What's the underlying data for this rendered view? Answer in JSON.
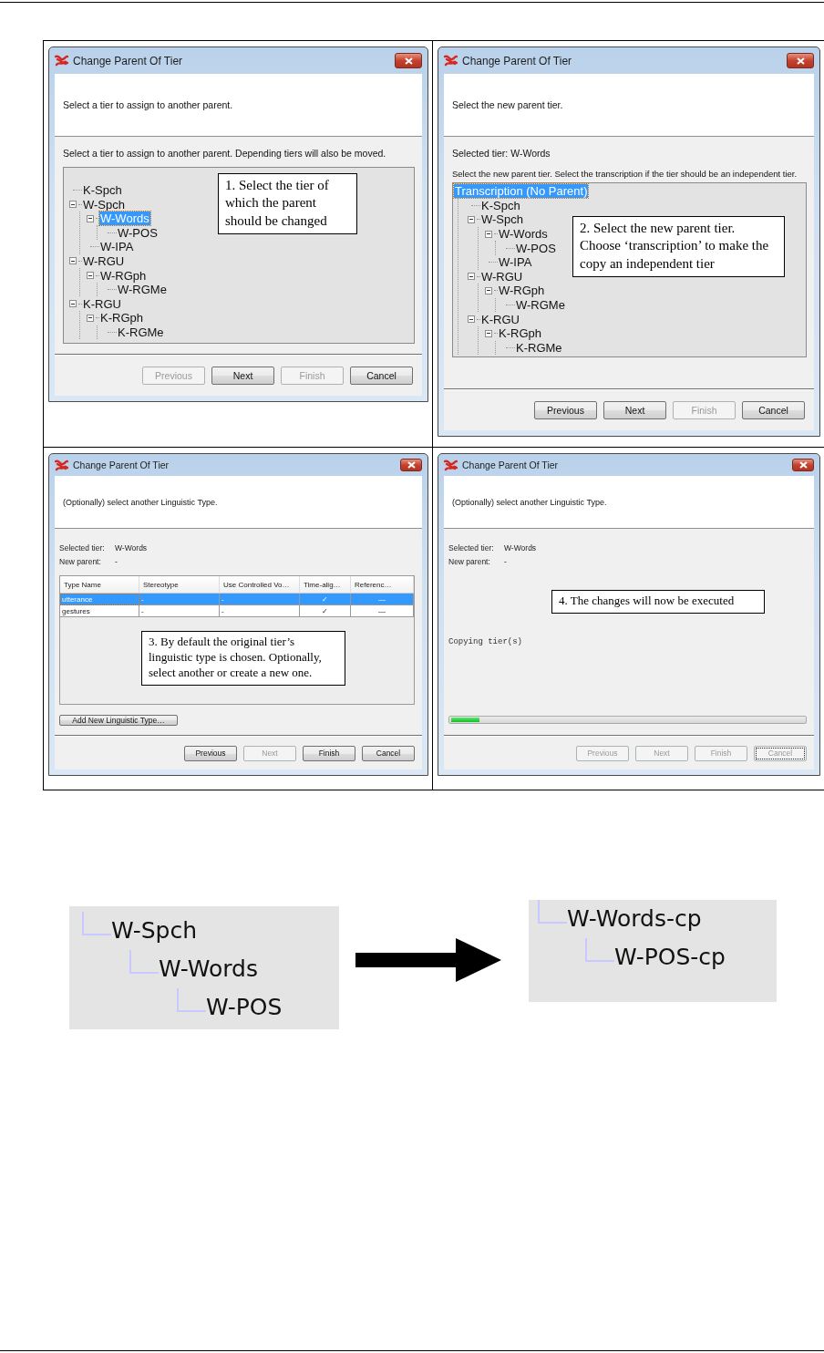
{
  "panels": [
    {
      "kind": "tier_select",
      "title": "Change Parent Of Tier",
      "header": "Select a tier to assign to another parent.",
      "prompt": "Select a tier to assign to another parent. Depending tiers will also be moved.",
      "tree": [
        {
          "label": "K-Spch",
          "selected": false
        },
        {
          "label": "W-Spch",
          "selected": false,
          "expanded": true,
          "children": [
            {
              "label": "W-Words",
              "selected": true,
              "expanded": true,
              "children": [
                {
                  "label": "W-POS",
                  "selected": false
                }
              ]
            },
            {
              "label": "W-IPA",
              "selected": false
            }
          ]
        },
        {
          "label": "W-RGU",
          "selected": false,
          "expanded": true,
          "children": [
            {
              "label": "W-RGph",
              "selected": false,
              "expanded": true,
              "children": [
                {
                  "label": "W-RGMe",
                  "selected": false
                }
              ]
            }
          ]
        },
        {
          "label": "K-RGU",
          "selected": false,
          "expanded": true,
          "children": [
            {
              "label": "K-RGph",
              "selected": false,
              "expanded": true,
              "children": [
                {
                  "label": "K-RGMe",
                  "selected": false
                }
              ]
            }
          ]
        }
      ],
      "callout": "1. Select the tier of which the parent should be changed",
      "buttons": [
        {
          "label": "Previous",
          "disabled": true,
          "focused": false
        },
        {
          "label": "Next",
          "disabled": false,
          "focused": false
        },
        {
          "label": "Finish",
          "disabled": true,
          "focused": false
        },
        {
          "label": "Cancel",
          "disabled": false,
          "focused": false
        }
      ]
    },
    {
      "kind": "parent_select",
      "title": "Change Parent Of Tier",
      "header": "Select the new parent tier.",
      "selected_tier": "Selected tier: W-Words",
      "prompt": "Select the new parent tier. Select the transcription if the tier should be an independent tier.",
      "tree": [
        {
          "label": "Transcription (No Parent)",
          "selected": true,
          "children": [
            {
              "label": "K-Spch",
              "selected": false
            },
            {
              "label": "W-Spch",
              "selected": false,
              "expanded": true,
              "children": [
                {
                  "label": "W-Words",
                  "selected": false,
                  "expanded": true,
                  "children": [
                    {
                      "label": "W-POS",
                      "selected": false
                    }
                  ]
                },
                {
                  "label": "W-IPA",
                  "selected": false
                }
              ]
            },
            {
              "label": "W-RGU",
              "selected": false,
              "expanded": true,
              "children": [
                {
                  "label": "W-RGph",
                  "selected": false,
                  "expanded": true,
                  "children": [
                    {
                      "label": "W-RGMe",
                      "selected": false
                    }
                  ]
                }
              ]
            },
            {
              "label": "K-RGU",
              "selected": false,
              "expanded": true,
              "children": [
                {
                  "label": "K-RGph",
                  "selected": false,
                  "expanded": true,
                  "children": [
                    {
                      "label": "K-RGMe",
                      "selected": false
                    }
                  ]
                }
              ]
            }
          ]
        }
      ],
      "callout": "2. Select the new parent tier. Choose ‘transcription’ to make the copy an independent tier",
      "buttons": [
        {
          "label": "Previous",
          "disabled": false,
          "focused": false
        },
        {
          "label": "Next",
          "disabled": false,
          "focused": false
        },
        {
          "label": "Finish",
          "disabled": true,
          "focused": false
        },
        {
          "label": "Cancel",
          "disabled": false,
          "focused": false
        }
      ]
    },
    {
      "kind": "type_select",
      "title": "Change Parent Of Tier",
      "header": "(Optionally) select another Linguistic Type.",
      "info": [
        {
          "label": "Selected tier:",
          "value": "W-Words"
        },
        {
          "label": "New parent:",
          "value": "-"
        }
      ],
      "table": {
        "columns": [
          "Type Name",
          "Stereotype",
          "Use Controlled Vo…",
          "Time-alig…",
          "Referenc…"
        ],
        "rows": [
          {
            "selected": true,
            "cells": [
              "utterance",
              "-",
              "-",
              "✓",
              "—"
            ]
          },
          {
            "selected": false,
            "cells": [
              "gestures",
              "-",
              "-",
              "✓",
              "—"
            ]
          }
        ]
      },
      "callout": "3. By default the original tier’s linguistic type is chosen. Optionally, select another or create a new one.",
      "add_button": "Add New Linguistic Type…",
      "buttons": [
        {
          "label": "Previous",
          "disabled": false,
          "focused": false
        },
        {
          "label": "Next",
          "disabled": true,
          "focused": false
        },
        {
          "label": "Finish",
          "disabled": false,
          "focused": false
        },
        {
          "label": "Cancel",
          "disabled": false,
          "focused": false
        }
      ]
    },
    {
      "kind": "progress",
      "title": "Change Parent Of Tier",
      "header": "(Optionally) select another Linguistic Type.",
      "info": [
        {
          "label": "Selected tier:",
          "value": "W-Words"
        },
        {
          "label": "New parent:",
          "value": "-"
        }
      ],
      "callout": "4. The changes will now be executed",
      "status": "Copying tier(s)",
      "level": 0.08,
      "buttons": [
        {
          "label": "Previous",
          "disabled": true,
          "focused": false
        },
        {
          "label": "Next",
          "disabled": true,
          "focused": false
        },
        {
          "label": "Finish",
          "disabled": true,
          "focused": false
        },
        {
          "label": "Cancel",
          "disabled": true,
          "focused": true
        }
      ]
    }
  ],
  "figure": {
    "before": [
      {
        "label": "W-Spch",
        "children": [
          {
            "label": "W-Words",
            "children": [
              {
                "label": "W-POS"
              }
            ]
          }
        ]
      }
    ],
    "after": [
      {
        "label": "W-Words-cp",
        "children": [
          {
            "label": "W-POS-cp"
          }
        ]
      }
    ]
  }
}
